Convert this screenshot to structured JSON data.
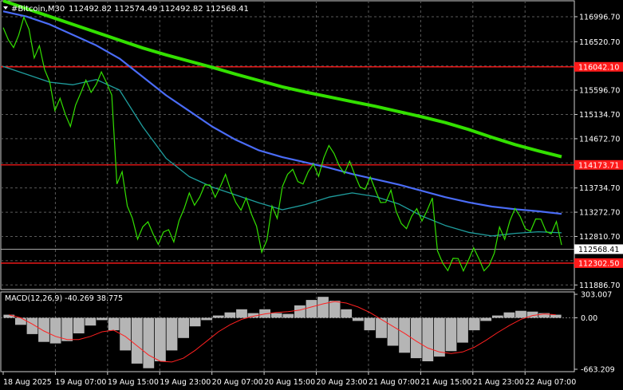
{
  "chart_data": {
    "type": "line",
    "header": {
      "symbol": "#Bitcoin,M30",
      "ohlc": "112492.82 112574.49 112492.82 112568.41"
    },
    "price_axis": {
      "ticks": [
        116996.7,
        116520.7,
        116058.7,
        115596.7,
        115134.7,
        114672.7,
        114210.7,
        113734.7,
        113272.7,
        112810.7,
        112348.7,
        111886.7
      ],
      "tick_labels": [
        "116996.70",
        "116520.70",
        "",
        "115596.70",
        "115134.70",
        "114672.70",
        "",
        "113734.70",
        "113272.70",
        "112810.70",
        "",
        "111886.70"
      ],
      "range": [
        111800,
        117300
      ]
    },
    "time_axis": {
      "labels": [
        "18 Aug 2025",
        "19 Aug 07:00",
        "19 Aug 15:00",
        "19 Aug 23:00",
        "20 Aug 07:00",
        "20 Aug 15:00",
        "20 Aug 23:00",
        "21 Aug 07:00",
        "21 Aug 15:00",
        "21 Aug 23:00",
        "22 Aug 07:00"
      ]
    },
    "levels": [
      {
        "label": "116042.10",
        "value": 116042.1,
        "color": "#ff1a1a"
      },
      {
        "label": "114173.71",
        "value": 114173.71,
        "color": "#ff1a1a"
      },
      {
        "label": "112302.50",
        "value": 112302.5,
        "color": "#ff1a1a"
      }
    ],
    "current_price": {
      "label": "112568.41",
      "value": 112568.41
    },
    "price_series": [
      116700,
      116500,
      116900,
      116300,
      115900,
      115300,
      115050,
      115400,
      115700,
      115800,
      115650,
      113900,
      113300,
      112850,
      113000,
      112750,
      112850,
      113200,
      113550,
      113650,
      113700,
      113850,
      113600,
      113400,
      113150,
      112600,
      113300,
      113850,
      114000,
      113900,
      114100,
      114400,
      114300,
      114100,
      113900,
      113800,
      113600,
      113550,
      113200,
      113050,
      113250,
      113400,
      112450,
      112250,
      112300,
      112450,
      112300,
      112350,
      112900,
      113200,
      113100,
      113000,
      113050,
      112950,
      112560
    ],
    "moving_averages": [
      {
        "color": "#33e000",
        "values": [
          117300,
          117150,
          117000,
          116850,
          116700,
          116550,
          116400,
          116270,
          116150,
          116030,
          115900,
          115780,
          115660,
          115560,
          115470,
          115380,
          115290,
          115190,
          115090,
          114980,
          114850,
          114700,
          114560,
          114440,
          114330
        ]
      },
      {
        "color": "#4a6cf7",
        "values": [
          117100,
          117000,
          116850,
          116650,
          116450,
          116200,
          115850,
          115500,
          115200,
          114900,
          114650,
          114450,
          114320,
          114220,
          114120,
          114000,
          113900,
          113800,
          113680,
          113560,
          113460,
          113380,
          113330,
          113290,
          113240
        ]
      },
      {
        "color": "#1f9e9e",
        "values": [
          116050,
          115900,
          115750,
          115700,
          115800,
          115600,
          114900,
          114300,
          113950,
          113750,
          113600,
          113450,
          113320,
          113420,
          113560,
          113640,
          113570,
          113430,
          113200,
          113020,
          112890,
          112820,
          112870,
          112900,
          112880
        ]
      }
    ],
    "macd": {
      "label": "MACD(12,26,9) -40.269 38.775",
      "axis_labels": [
        "303.007",
        "0.00",
        "-663.209"
      ],
      "histogram": [
        40,
        -90,
        -210,
        -310,
        -330,
        -300,
        -200,
        -100,
        -30,
        -160,
        -420,
        -590,
        -650,
        -560,
        -420,
        -260,
        -110,
        -30,
        30,
        70,
        110,
        60,
        110,
        60,
        50,
        160,
        230,
        270,
        220,
        110,
        -40,
        -160,
        -260,
        -360,
        -450,
        -520,
        -560,
        -500,
        -430,
        -320,
        -160,
        -40,
        30,
        70,
        90,
        80,
        60,
        40
      ],
      "signal": [
        40,
        0,
        -80,
        -170,
        -240,
        -280,
        -280,
        -240,
        -180,
        -160,
        -240,
        -360,
        -480,
        -560,
        -570,
        -520,
        -420,
        -300,
        -180,
        -90,
        -20,
        20,
        50,
        70,
        80,
        100,
        140,
        180,
        210,
        190,
        140,
        70,
        -20,
        -110,
        -200,
        -300,
        -390,
        -440,
        -460,
        -440,
        -380,
        -290,
        -190,
        -100,
        -20,
        30,
        50,
        40
      ]
    }
  }
}
